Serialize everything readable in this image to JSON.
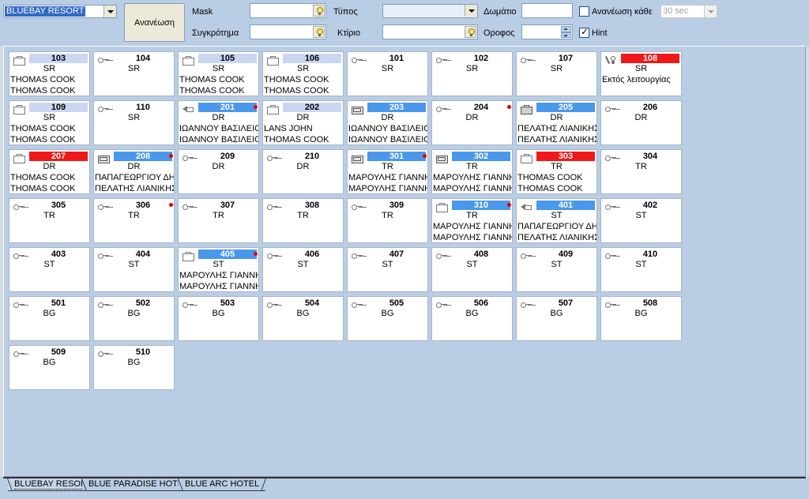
{
  "toolbar": {
    "hotel_select": "BLUEBAY RESORT",
    "refresh_label": "Ανανέωση",
    "mask_label": "Mask",
    "mask_value": "",
    "complex_label": "Συγκρότημα",
    "complex_value": "",
    "type_label": "Τύπος",
    "type_value": "",
    "building_label": "Κτίριο",
    "building_value": "",
    "room_label": "Δωμάτιο",
    "room_value": "",
    "floor_label": "Οροφος",
    "floor_value": "",
    "auto_refresh_label": "Ανανέωση κάθε",
    "auto_refresh_checked": false,
    "interval_value": "30 sec",
    "hint_label": "Hint",
    "hint_checked": true
  },
  "rooms": [
    {
      "number": "103",
      "type": "SR",
      "icon": "case",
      "highlight": "lav",
      "dot": false,
      "guest1": "THOMAS COOK",
      "guest2": "THOMAS COOK"
    },
    {
      "number": "104",
      "type": "SR",
      "icon": "key",
      "highlight": "",
      "dot": false,
      "guest1": "",
      "guest2": ""
    },
    {
      "number": "105",
      "type": "SR",
      "icon": "case",
      "highlight": "lav",
      "dot": false,
      "guest1": "THOMAS COOK",
      "guest2": "THOMAS COOK"
    },
    {
      "number": "106",
      "type": "SR",
      "icon": "case",
      "highlight": "lav",
      "dot": false,
      "guest1": "THOMAS COOK",
      "guest2": "THOMAS COOK"
    },
    {
      "number": "101",
      "type": "SR",
      "icon": "key",
      "highlight": "",
      "dot": false,
      "guest1": "",
      "guest2": ""
    },
    {
      "number": "102",
      "type": "SR",
      "icon": "key",
      "highlight": "",
      "dot": false,
      "guest1": "",
      "guest2": ""
    },
    {
      "number": "107",
      "type": "SR",
      "icon": "key",
      "highlight": "",
      "dot": false,
      "guest1": "",
      "guest2": ""
    },
    {
      "number": "108",
      "type": "SR",
      "icon": "tools",
      "highlight": "red",
      "dot": false,
      "guest1": "Εκτός λειτουργίας",
      "guest2": ""
    },
    {
      "number": "109",
      "type": "SR",
      "icon": "case",
      "highlight": "lav",
      "dot": false,
      "guest1": "THOMAS COOK",
      "guest2": "THOMAS COOK"
    },
    {
      "number": "110",
      "type": "SR",
      "icon": "key",
      "highlight": "",
      "dot": false,
      "guest1": "",
      "guest2": ""
    },
    {
      "number": "201",
      "type": "DR",
      "icon": "arrow",
      "highlight": "blue",
      "dot": true,
      "guest1": "ΙΩΑΝΝΟΥ ΒΑΣΙΛΕΙΟΣ",
      "guest2": "ΙΩΑΝΝΟΥ ΒΑΣΙΛΕΙΟΣ"
    },
    {
      "number": "202",
      "type": "DR",
      "icon": "case",
      "highlight": "lav",
      "dot": false,
      "guest1": "LANS JOHN",
      "guest2": "THOMAS COOK"
    },
    {
      "number": "203",
      "type": "DR",
      "icon": "case2",
      "highlight": "blue",
      "dot": false,
      "guest1": "ΙΩΑΝΝΟΥ ΒΑΣΙΛΕΙΟΣ",
      "guest2": "ΙΩΑΝΝΟΥ ΒΑΣΙΛΕΙΟΣ"
    },
    {
      "number": "204",
      "type": "DR",
      "icon": "key",
      "highlight": "",
      "dot": true,
      "guest1": "",
      "guest2": ""
    },
    {
      "number": "205",
      "type": "DR",
      "icon": "case3",
      "highlight": "blue",
      "dot": false,
      "guest1": "ΠΕΛΑΤΗΣ ΛΙΑΝΙΚΗΣ",
      "guest2": "ΠΕΛΑΤΗΣ ΛΙΑΝΙΚΗΣ"
    },
    {
      "number": "206",
      "type": "DR",
      "icon": "key",
      "highlight": "",
      "dot": false,
      "guest1": "",
      "guest2": ""
    },
    {
      "number": "207",
      "type": "DR",
      "icon": "case",
      "highlight": "red",
      "dot": false,
      "guest1": "THOMAS COOK",
      "guest2": "THOMAS COOK"
    },
    {
      "number": "208",
      "type": "DR",
      "icon": "case2",
      "highlight": "blue",
      "dot": true,
      "guest1": "ΠΑΠΑΓΕΩΡΓΙΟΥ ΔΗΜ",
      "guest2": "ΠΕΛΑΤΗΣ ΛΙΑΝΙΚΗΣ"
    },
    {
      "number": "209",
      "type": "DR",
      "icon": "key",
      "highlight": "",
      "dot": false,
      "guest1": "",
      "guest2": ""
    },
    {
      "number": "210",
      "type": "DR",
      "icon": "key",
      "highlight": "",
      "dot": false,
      "guest1": "",
      "guest2": ""
    },
    {
      "number": "301",
      "type": "TR",
      "icon": "case2",
      "highlight": "blue",
      "dot": true,
      "guest1": "ΜΑΡΟΥΛΗΣ ΓΙΑΝΝΗΣ",
      "guest2": "ΜΑΡΟΥΛΗΣ ΓΙΑΝΝΗΣ"
    },
    {
      "number": "302",
      "type": "TR",
      "icon": "case2",
      "highlight": "blue",
      "dot": false,
      "guest1": "ΜΑΡΟΥΛΗΣ ΓΙΑΝΝΗΣ",
      "guest2": "ΜΑΡΟΥΛΗΣ ΓΙΑΝΝΗΣ"
    },
    {
      "number": "303",
      "type": "TR",
      "icon": "case",
      "highlight": "red",
      "dot": false,
      "guest1": "THOMAS COOK",
      "guest2": "THOMAS COOK"
    },
    {
      "number": "304",
      "type": "TR",
      "icon": "key",
      "highlight": "",
      "dot": false,
      "guest1": "",
      "guest2": ""
    },
    {
      "number": "305",
      "type": "TR",
      "icon": "key",
      "highlight": "",
      "dot": false,
      "guest1": "",
      "guest2": ""
    },
    {
      "number": "306",
      "type": "TR",
      "icon": "key",
      "highlight": "",
      "dot": true,
      "guest1": "",
      "guest2": ""
    },
    {
      "number": "307",
      "type": "TR",
      "icon": "key",
      "highlight": "",
      "dot": false,
      "guest1": "",
      "guest2": ""
    },
    {
      "number": "308",
      "type": "TR",
      "icon": "key",
      "highlight": "",
      "dot": false,
      "guest1": "",
      "guest2": ""
    },
    {
      "number": "309",
      "type": "TR",
      "icon": "key",
      "highlight": "",
      "dot": false,
      "guest1": "",
      "guest2": ""
    },
    {
      "number": "310",
      "type": "TR",
      "icon": "case",
      "highlight": "blue",
      "dot": true,
      "guest1": "ΜΑΡΟΥΛΗΣ ΓΙΑΝΝΗΣ",
      "guest2": "ΜΑΡΟΥΛΗΣ ΓΙΑΝΝΗΣ"
    },
    {
      "number": "401",
      "type": "ST",
      "icon": "arrow",
      "highlight": "blue",
      "dot": false,
      "guest1": "ΠΑΠΑΓΕΩΡΓΙΟΥ ΔΗΜ",
      "guest2": "ΠΕΛΑΤΗΣ ΛΙΑΝΙΚΗΣ"
    },
    {
      "number": "402",
      "type": "ST",
      "icon": "key",
      "highlight": "",
      "dot": false,
      "guest1": "",
      "guest2": ""
    },
    {
      "number": "403",
      "type": "ST",
      "icon": "key",
      "highlight": "",
      "dot": false,
      "guest1": "",
      "guest2": ""
    },
    {
      "number": "404",
      "type": "ST",
      "icon": "key",
      "highlight": "",
      "dot": false,
      "guest1": "",
      "guest2": ""
    },
    {
      "number": "405",
      "type": "ST",
      "icon": "case",
      "highlight": "blue",
      "dot": true,
      "guest1": "ΜΑΡΟΥΛΗΣ ΓΙΑΝΝΗΣ",
      "guest2": "ΜΑΡΟΥΛΗΣ ΓΙΑΝΝΗΣ"
    },
    {
      "number": "406",
      "type": "ST",
      "icon": "key",
      "highlight": "",
      "dot": false,
      "guest1": "",
      "guest2": ""
    },
    {
      "number": "407",
      "type": "ST",
      "icon": "key",
      "highlight": "",
      "dot": false,
      "guest1": "",
      "guest2": ""
    },
    {
      "number": "408",
      "type": "ST",
      "icon": "key",
      "highlight": "",
      "dot": false,
      "guest1": "",
      "guest2": ""
    },
    {
      "number": "409",
      "type": "ST",
      "icon": "key",
      "highlight": "",
      "dot": false,
      "guest1": "",
      "guest2": ""
    },
    {
      "number": "410",
      "type": "ST",
      "icon": "key",
      "highlight": "",
      "dot": false,
      "guest1": "",
      "guest2": ""
    },
    {
      "number": "501",
      "type": "BG",
      "icon": "key",
      "highlight": "",
      "dot": false,
      "guest1": "",
      "guest2": ""
    },
    {
      "number": "502",
      "type": "BG",
      "icon": "key",
      "highlight": "",
      "dot": false,
      "guest1": "",
      "guest2": ""
    },
    {
      "number": "503",
      "type": "BG",
      "icon": "key",
      "highlight": "",
      "dot": false,
      "guest1": "",
      "guest2": ""
    },
    {
      "number": "504",
      "type": "BG",
      "icon": "key",
      "highlight": "",
      "dot": false,
      "guest1": "",
      "guest2": ""
    },
    {
      "number": "505",
      "type": "BG",
      "icon": "key",
      "highlight": "",
      "dot": false,
      "guest1": "",
      "guest2": ""
    },
    {
      "number": "506",
      "type": "BG",
      "icon": "key",
      "highlight": "",
      "dot": false,
      "guest1": "",
      "guest2": ""
    },
    {
      "number": "507",
      "type": "BG",
      "icon": "key",
      "highlight": "",
      "dot": false,
      "guest1": "",
      "guest2": ""
    },
    {
      "number": "508",
      "type": "BG",
      "icon": "key",
      "highlight": "",
      "dot": false,
      "guest1": "",
      "guest2": ""
    },
    {
      "number": "509",
      "type": "BG",
      "icon": "key",
      "highlight": "",
      "dot": false,
      "guest1": "",
      "guest2": ""
    },
    {
      "number": "510",
      "type": "BG",
      "icon": "key",
      "highlight": "",
      "dot": false,
      "guest1": "",
      "guest2": ""
    }
  ],
  "tabs": [
    {
      "label": "BLUEBAY RESORT",
      "active": true
    },
    {
      "label": "BLUE PARADISE HOTEL",
      "active": false
    },
    {
      "label": "BLUE ARC HOTEL",
      "active": false
    }
  ],
  "colors": {
    "occupied_blue": "#4a98ec",
    "out_of_order_red": "#f01818",
    "reserved_lavender": "#cbd6f3",
    "alert_dot": "#e00000"
  }
}
